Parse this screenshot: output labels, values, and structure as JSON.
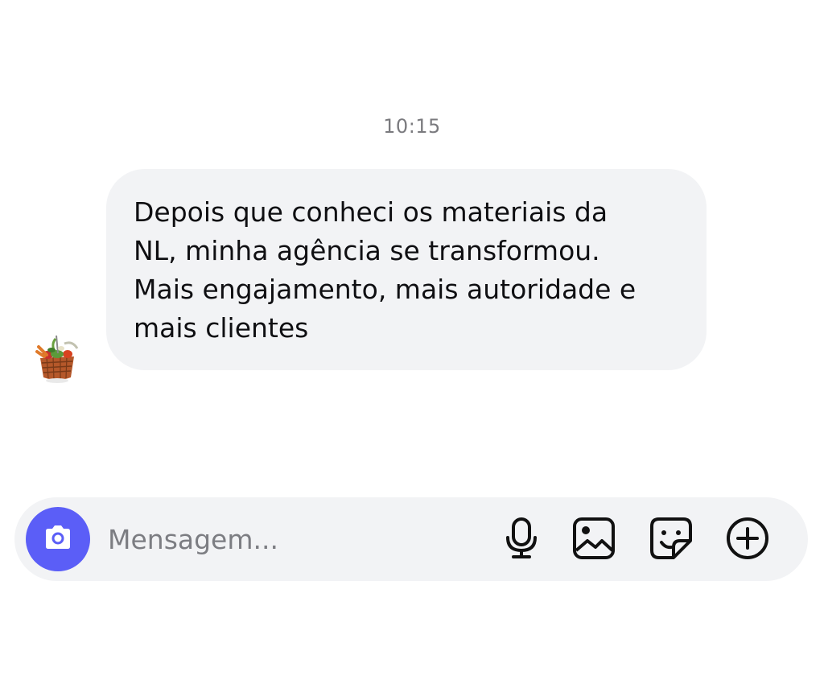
{
  "timestamp": "10:15",
  "message": {
    "text": "Depois que conheci os materiais da\nNL, minha agência se transformou.\nMais engajamento, mais autoridade e\nmais clientes"
  },
  "composer": {
    "placeholder": "Mensagem...",
    "value": "",
    "camera_icon": "camera-icon",
    "mic_icon": "microphone-icon",
    "gallery_icon": "image-icon",
    "sticker_icon": "sticker-icon",
    "add_icon": "plus-circle-icon"
  },
  "colors": {
    "accent": "#5b5ef7",
    "bubble_bg": "#f2f3f5",
    "timestamp": "#7a7a7e"
  }
}
